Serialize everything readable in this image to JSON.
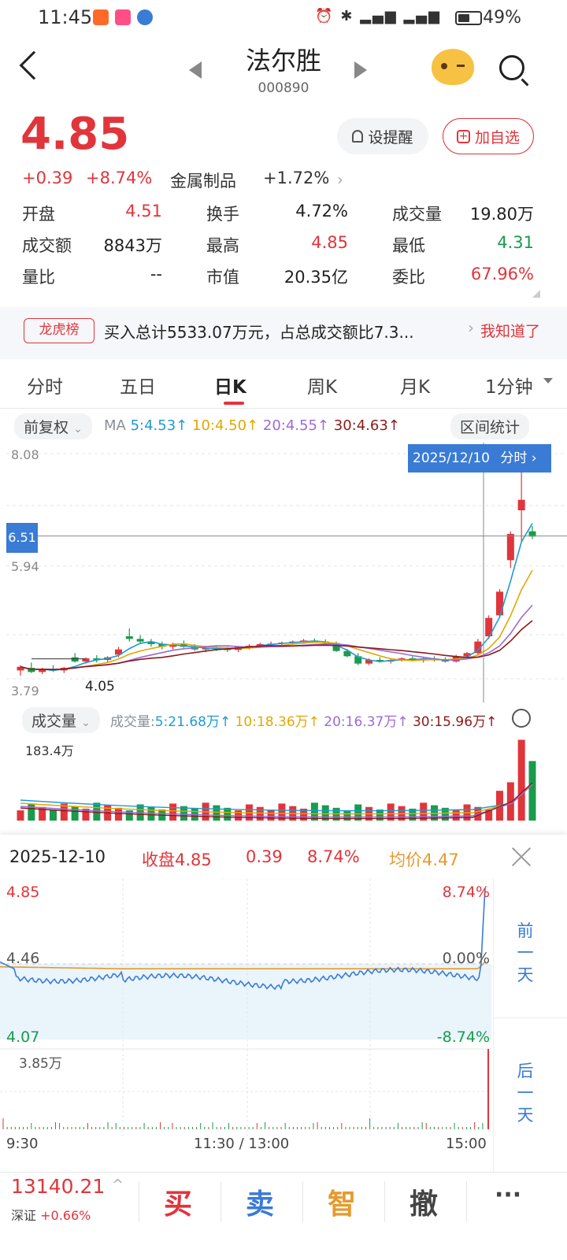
{
  "status": {
    "time": "11:45",
    "battery": "49%",
    "net1": "4G",
    "net2": "4G"
  },
  "header": {
    "name": "法尔胜",
    "code": "000890"
  },
  "quote": {
    "price": "4.85",
    "change": "+0.39",
    "change_pct": "+8.74%",
    "sector": "金属制品",
    "sector_change": "+1.72%",
    "alert_label": "设提醒",
    "fav_label": "加自选",
    "open_label": "开盘",
    "open": "4.51",
    "turnover_label": "换手",
    "turnover": "4.72%",
    "volume_label": "成交量",
    "volume": "19.80万",
    "amount_label": "成交额",
    "amount": "8843万",
    "high_label": "最高",
    "high": "4.85",
    "low_label": "最低",
    "low": "4.31",
    "vr_label": "量比",
    "vr": "--",
    "mcap_label": "市值",
    "mcap": "20.35亿",
    "wb_label": "委比",
    "wb": "67.96%"
  },
  "banner": {
    "tag": "龙虎榜",
    "text": "买入总计5533.07万元，占总成交额比7.3...",
    "action": "我知道了"
  },
  "tabs": [
    "分时",
    "五日",
    "日K",
    "周K",
    "月K",
    "1分钟"
  ],
  "kline": {
    "adjust": "前复权",
    "ma_title": "MA",
    "ma5": "5:4.53↑",
    "ma10": "10:4.50↑",
    "ma20": "20:4.55↑",
    "ma30": "30:4.63↑",
    "range_stats": "区间统计",
    "y_top": "8.08",
    "y_mid": "5.94",
    "y_bot": "3.79",
    "low_mark": "4.05",
    "cursor_price": "6.51",
    "cursor_date": "2025/12/10",
    "cursor_link": "分时",
    "vol_title": "成交量",
    "vol_label": "成交量:",
    "vma5": "5:21.68万↑",
    "vma10": "10:18.36万↑",
    "vma20": "20:16.37万↑",
    "vma30": "30:15.96万↑",
    "vol_max": "183.4万"
  },
  "chart_data": {
    "type": "candlestick",
    "series": [
      {
        "name": "price",
        "ohlc": [
          [
            3.95,
            4.05,
            3.85,
            4.02
          ],
          [
            4.0,
            4.1,
            3.9,
            3.92
          ],
          [
            3.92,
            4.0,
            3.88,
            3.98
          ],
          [
            3.98,
            4.05,
            3.92,
            3.95
          ],
          [
            3.95,
            4.02,
            3.9,
            4.0
          ],
          [
            4.2,
            4.28,
            4.1,
            4.12
          ],
          [
            4.12,
            4.2,
            4.08,
            4.18
          ],
          [
            4.18,
            4.24,
            4.1,
            4.15
          ],
          [
            4.15,
            4.22,
            4.1,
            4.2
          ],
          [
            4.25,
            4.4,
            4.2,
            4.35
          ],
          [
            4.6,
            4.75,
            4.5,
            4.55
          ],
          [
            4.55,
            4.62,
            4.45,
            4.5
          ],
          [
            4.5,
            4.55,
            4.4,
            4.45
          ],
          [
            4.45,
            4.5,
            4.35,
            4.4
          ],
          [
            4.4,
            4.48,
            4.35,
            4.45
          ],
          [
            4.45,
            4.52,
            4.38,
            4.4
          ],
          [
            4.4,
            4.45,
            4.32,
            4.35
          ],
          [
            4.35,
            4.4,
            4.3,
            4.38
          ],
          [
            4.38,
            4.42,
            4.32,
            4.36
          ],
          [
            4.36,
            4.4,
            4.3,
            4.34
          ],
          [
            4.34,
            4.42,
            4.3,
            4.4
          ],
          [
            4.4,
            4.45,
            4.35,
            4.42
          ],
          [
            4.42,
            4.48,
            4.38,
            4.45
          ],
          [
            4.45,
            4.5,
            4.4,
            4.46
          ],
          [
            4.46,
            4.5,
            4.42,
            4.48
          ],
          [
            4.48,
            4.52,
            4.44,
            4.5
          ],
          [
            4.5,
            4.55,
            4.46,
            4.52
          ],
          [
            4.52,
            4.56,
            4.48,
            4.5
          ],
          [
            4.5,
            4.54,
            4.45,
            4.47
          ],
          [
            4.47,
            4.5,
            4.3,
            4.32
          ],
          [
            4.32,
            4.36,
            4.2,
            4.22
          ],
          [
            4.22,
            4.28,
            4.05,
            4.08
          ],
          [
            4.08,
            4.18,
            4.05,
            4.15
          ],
          [
            4.15,
            4.2,
            4.1,
            4.12
          ],
          [
            4.12,
            4.18,
            4.08,
            4.15
          ],
          [
            4.15,
            4.2,
            4.12,
            4.18
          ],
          [
            4.18,
            4.22,
            4.12,
            4.14
          ],
          [
            4.14,
            4.2,
            4.1,
            4.18
          ],
          [
            4.18,
            4.22,
            4.12,
            4.15
          ],
          [
            4.15,
            4.2,
            4.1,
            4.12
          ],
          [
            4.12,
            4.25,
            4.1,
            4.22
          ],
          [
            4.22,
            4.3,
            4.18,
            4.28
          ],
          [
            4.28,
            4.55,
            4.25,
            4.5
          ],
          [
            4.6,
            5.0,
            4.55,
            4.95
          ],
          [
            5.0,
            5.5,
            4.95,
            5.45
          ],
          [
            6.05,
            6.6,
            5.9,
            6.55
          ],
          [
            7.0,
            7.9,
            6.4,
            7.2
          ],
          [
            6.6,
            6.7,
            6.45,
            6.5
          ]
        ]
      }
    ],
    "y_ticks": [
      "8.08",
      "5.94",
      "3.79"
    ]
  },
  "intraday": {
    "date": "2025-12-10",
    "close_label": "收盘4.85",
    "chg": "0.39",
    "pct": "8.74%",
    "avg_label": "均价4.47",
    "y_top": "4.85",
    "y_mid": "4.46",
    "y_bot": "4.07",
    "pct_top": "8.74%",
    "pct_mid": "0.00%",
    "pct_bot": "-8.74%",
    "vol_max": "3.85万",
    "t_start": "9:30",
    "t_mid": "11:30 / 13:00",
    "t_end": "15:00",
    "prev_day": "前一天",
    "next_day": "后一天"
  },
  "bottom": {
    "index_value": "13140.21",
    "index_name": "深证",
    "index_chg": "+0.66%",
    "buy": "买",
    "sell": "卖",
    "smart": "智",
    "cancel": "撤",
    "more": "···"
  },
  "colors": {
    "up": "#e0353b",
    "down": "#1a9b4b",
    "accent": "#3a7bd5"
  }
}
